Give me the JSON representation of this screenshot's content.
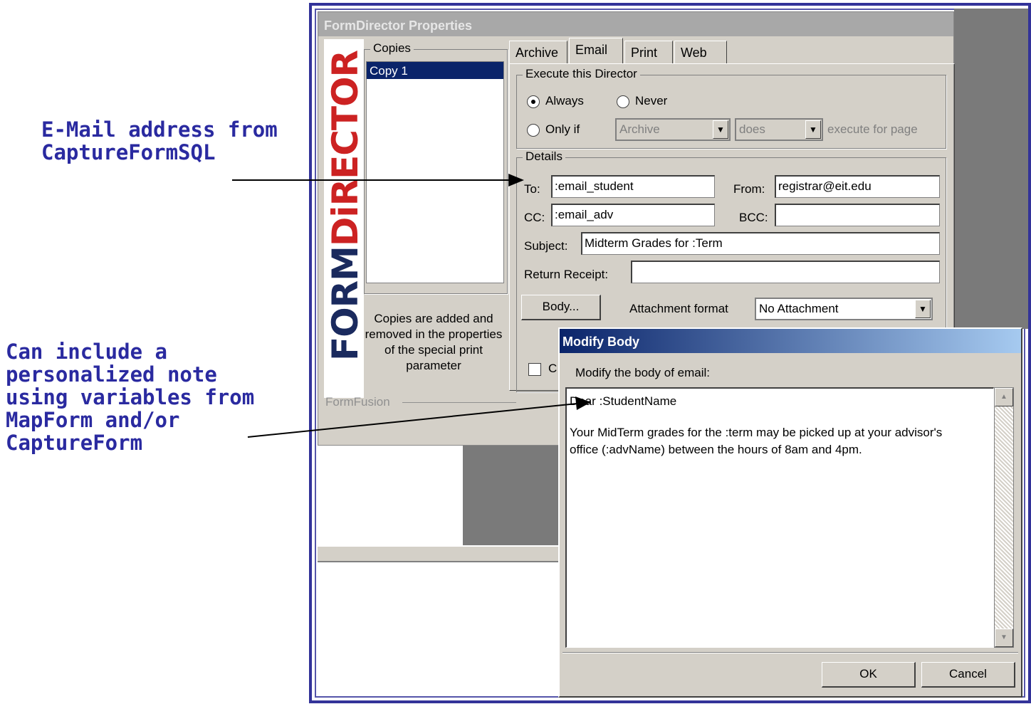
{
  "annotations": {
    "email_note": "E-Mail address from\nCaptureFormSQL",
    "body_note": "Can include a\npersonalized note\nusing variables from\nMapForm and/or\nCaptureForm"
  },
  "props_window": {
    "title": "FormDirector Properties",
    "logo_part1": "FORM",
    "logo_part2": "DiRECTOR",
    "copies_legend": "Copies",
    "copies_items": [
      "Copy 1"
    ],
    "copies_note": "Copies are added and removed in the properties of the special print parameter",
    "formfusion_legend": "FormFusion",
    "tabs": [
      "Archive",
      "Email",
      "Print",
      "Web"
    ],
    "active_tab": "Email",
    "execute": {
      "legend": "Execute this Director",
      "always": "Always",
      "never": "Never",
      "only_if": "Only if",
      "selected": "Always",
      "combo1": "Archive",
      "combo2": "does",
      "suffix": "execute for page"
    },
    "details": {
      "legend": "Details",
      "to_label": "To:",
      "to_value": ":email_student",
      "from_label": "From:",
      "from_value": "registrar@eit.edu",
      "cc_label": "CC:",
      "cc_value": ":email_adv",
      "bcc_label": "BCC:",
      "bcc_value": "",
      "subject_label": "Subject:",
      "subject_value": "Midterm Grades for :Term",
      "receipt_label": "Return Receipt:",
      "receipt_value": "",
      "body_button": "Body...",
      "attach_label": "Attachment format",
      "attach_value": "No Attachment",
      "checkbox_partial": "C"
    }
  },
  "modify_body": {
    "title": "Modify Body",
    "prompt": "Modify the body of email:",
    "line1": "Dear :StudentName",
    "line2": "Your MidTerm grades for the :term may be picked up at your advisor's",
    "line3": "office (:advName)  between the hours of 8am and 4pm.",
    "ok": "OK",
    "cancel": "Cancel"
  },
  "colors": {
    "frame": "#333399",
    "annotation": "#2a2aa0",
    "selection": "#0a246a",
    "logo_blue": "#1a2a5e",
    "logo_red": "#cc2222"
  }
}
